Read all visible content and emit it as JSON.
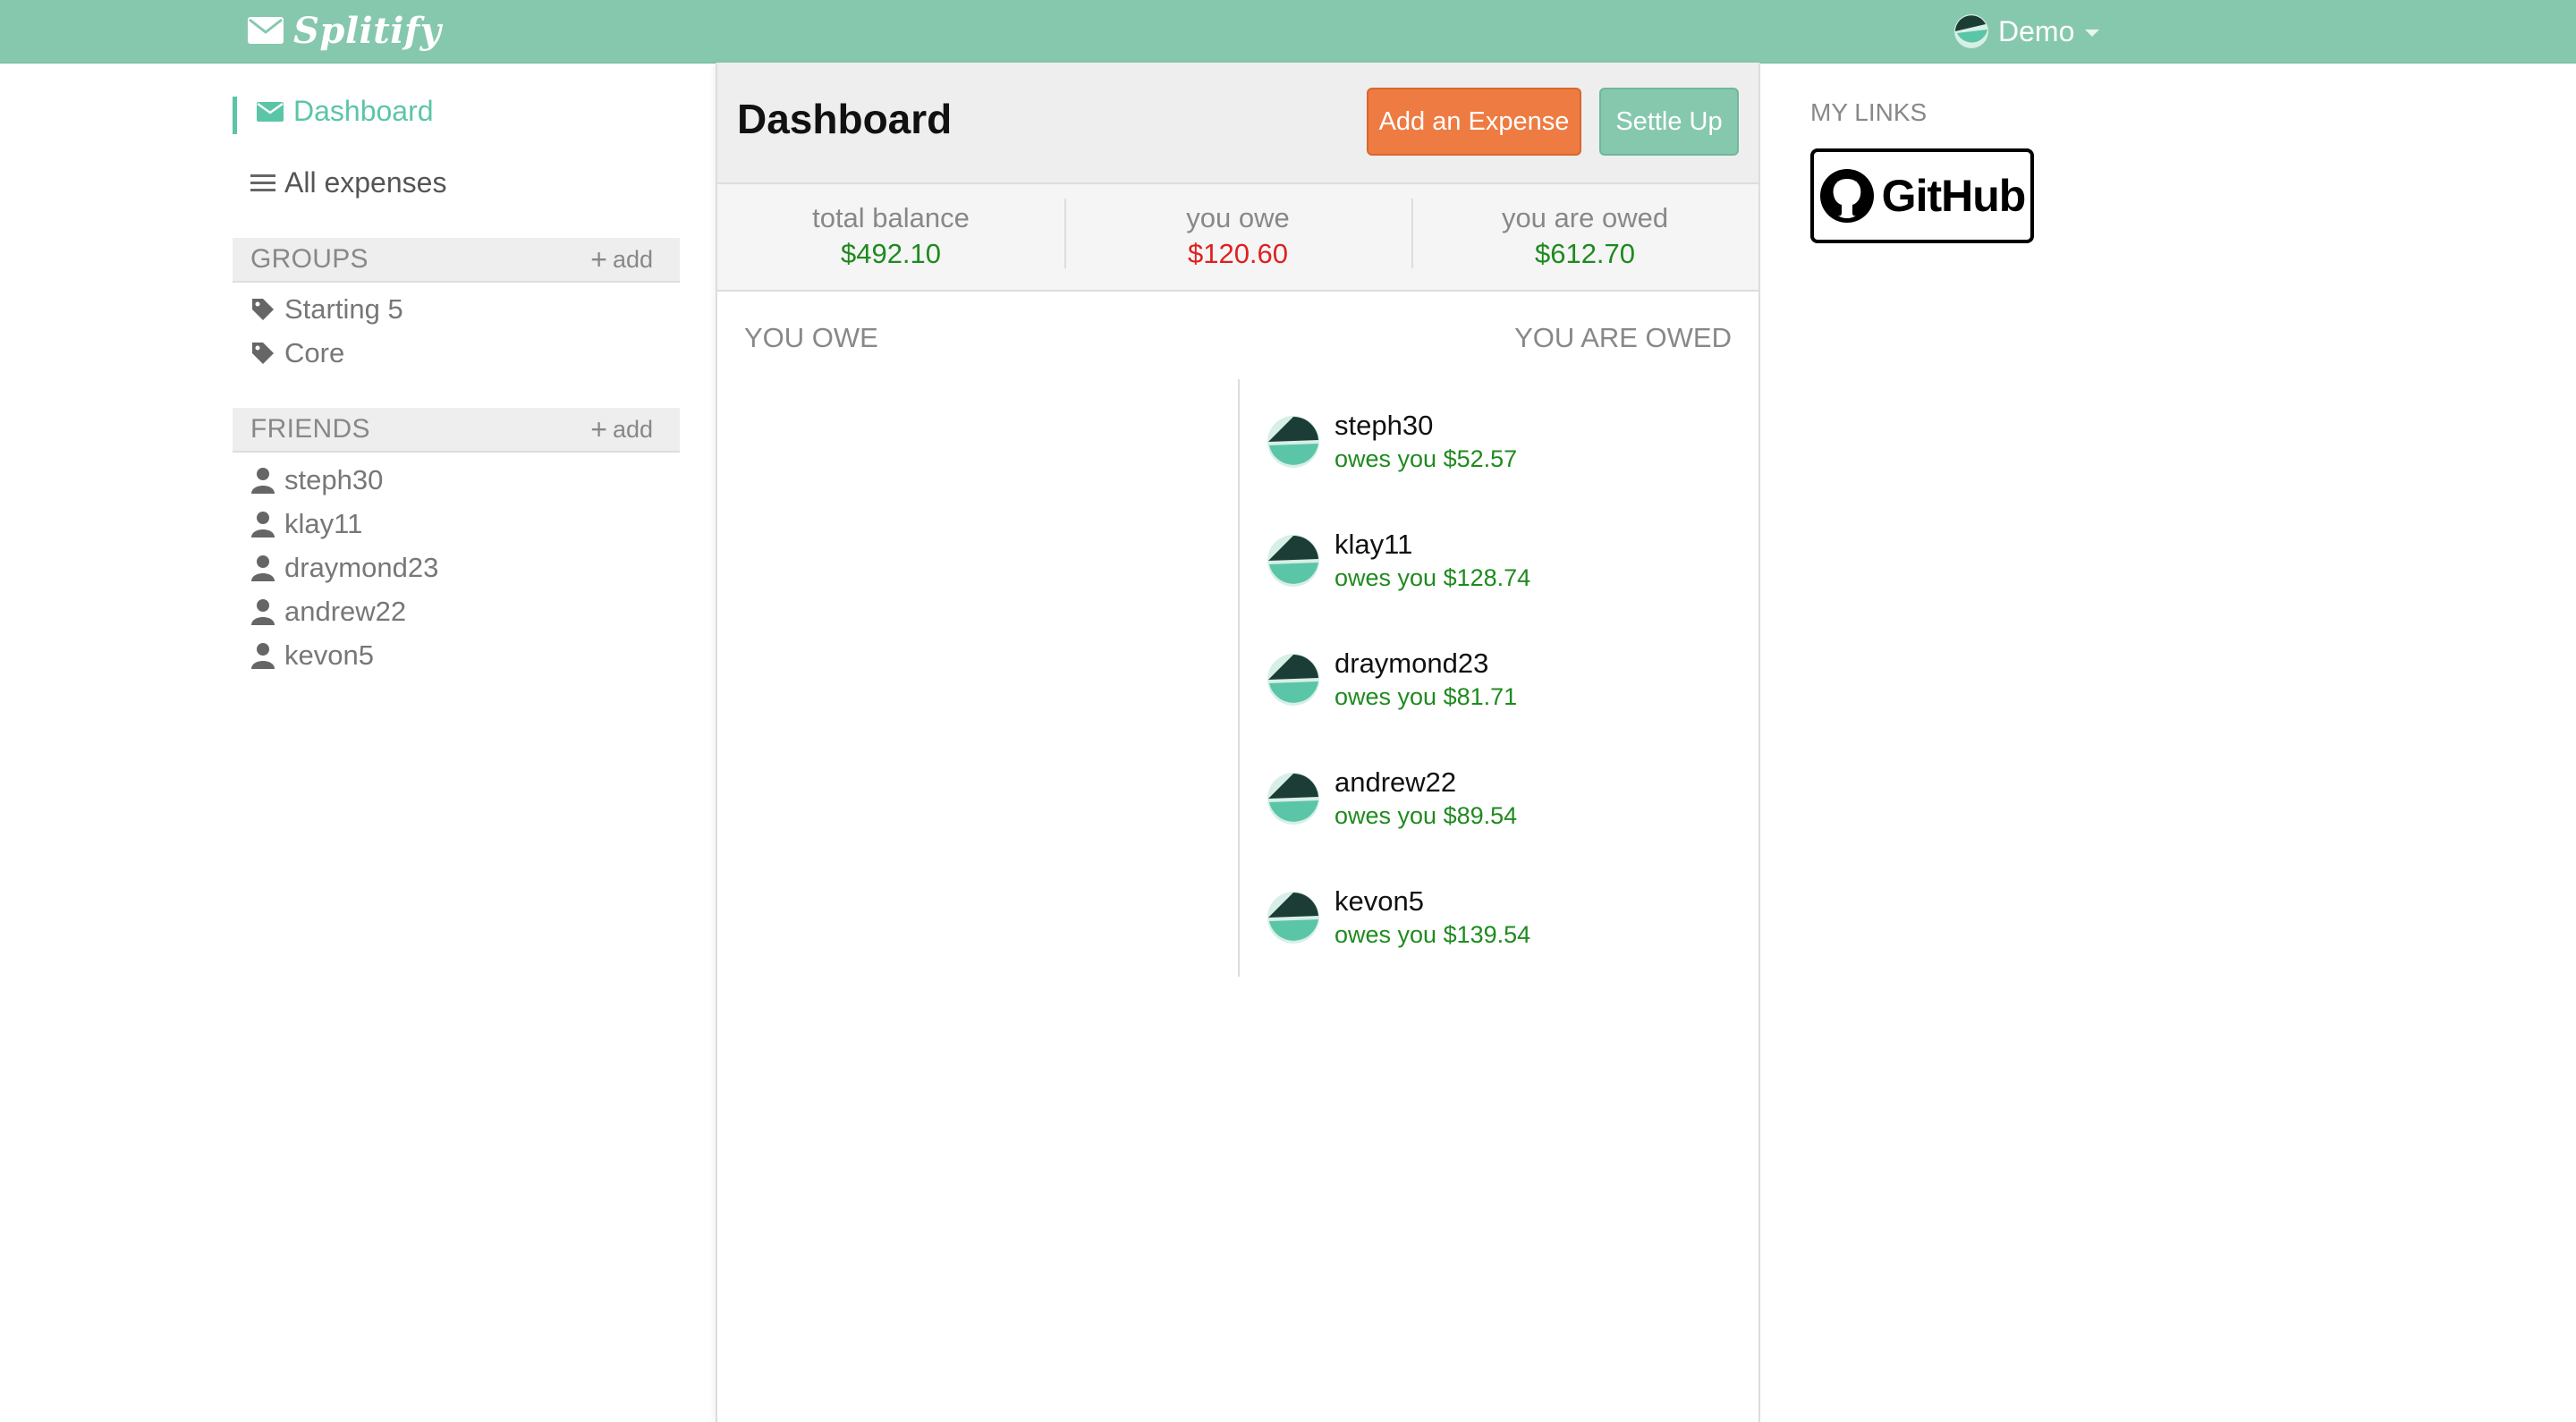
{
  "nav": {
    "brand": "Splitify",
    "user": "Demo"
  },
  "sidebar": {
    "dashboard_label": "Dashboard",
    "all_expenses_label": "All expenses",
    "groups_title": "GROUPS",
    "friends_title": "FRIENDS",
    "add_label": "add",
    "groups": [
      "Starting 5",
      "Core"
    ],
    "friends": [
      "steph30",
      "klay11",
      "draymond23",
      "andrew22",
      "kevon5"
    ]
  },
  "main": {
    "title": "Dashboard",
    "add_expense_label": "Add an Expense",
    "settle_up_label": "Settle Up",
    "balances": [
      {
        "label": "total balance",
        "value": "$492.10",
        "color": "#1f8a1f"
      },
      {
        "label": "you owe",
        "value": "$120.60",
        "color": "#e02020"
      },
      {
        "label": "you are owed",
        "value": "$612.70",
        "color": "#1f8a1f"
      }
    ],
    "you_owe_title": "YOU OWE",
    "you_are_owed_title": "YOU ARE OWED",
    "owed": [
      {
        "name": "steph30",
        "text": "owes you $52.57"
      },
      {
        "name": "klay11",
        "text": "owes you $128.74"
      },
      {
        "name": "draymond23",
        "text": "owes you $81.71"
      },
      {
        "name": "andrew22",
        "text": "owes you $89.54"
      },
      {
        "name": "kevon5",
        "text": "owes you $139.54"
      }
    ]
  },
  "right": {
    "links_title": "MY LINKS",
    "github_label": "GitHub"
  },
  "colors": {
    "accent": "#5bc5a7",
    "topbar": "#86c8ae",
    "orange": "#ee7b42",
    "positive": "#1f8a1f",
    "negative": "#e02020"
  }
}
